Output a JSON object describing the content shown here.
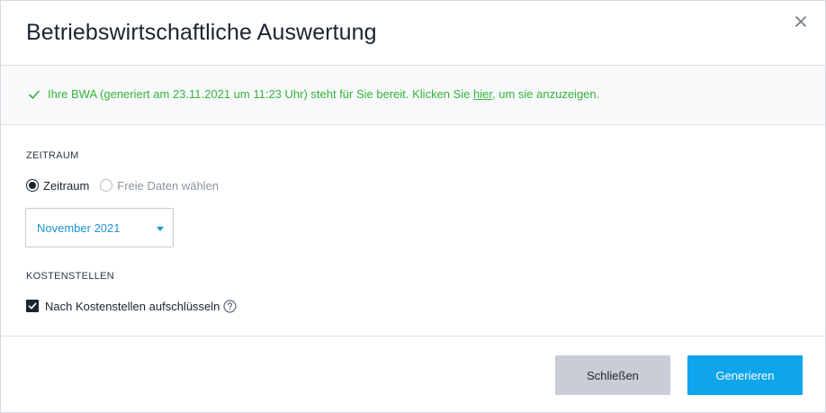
{
  "dialog": {
    "title": "Betriebswirtschaftliche Auswertung"
  },
  "notice": {
    "text_before": "Ihre BWA (generiert am 23.11.2021 um 11:23 Uhr) steht für Sie bereit. Klicken Sie ",
    "link_text": "hier",
    "text_after": ", um sie anzuzeigen.",
    "color": "#36b339"
  },
  "zeitraum": {
    "section_label": "ZEITRAUM",
    "options": [
      {
        "label": "Zeitraum",
        "selected": true
      },
      {
        "label": "Freie Daten wählen",
        "selected": false
      }
    ],
    "select_value": "November 2021"
  },
  "kostenstellen": {
    "section_label": "KOSTENSTELLEN",
    "checkbox_label": "Nach Kostenstellen aufschlüsseln",
    "checked": true
  },
  "footer": {
    "close_label": "Schließen",
    "generate_label": "Generieren"
  },
  "colors": {
    "accent": "#0ea5ec",
    "select_text": "#1a94d8",
    "secondary_button": "#c9ced6"
  },
  "icons": {
    "close": "close-icon",
    "notice": "checkmark-icon",
    "select": "caret-down-icon",
    "checkbox": "checkbox-checked-icon",
    "help": "help-circle-icon"
  }
}
